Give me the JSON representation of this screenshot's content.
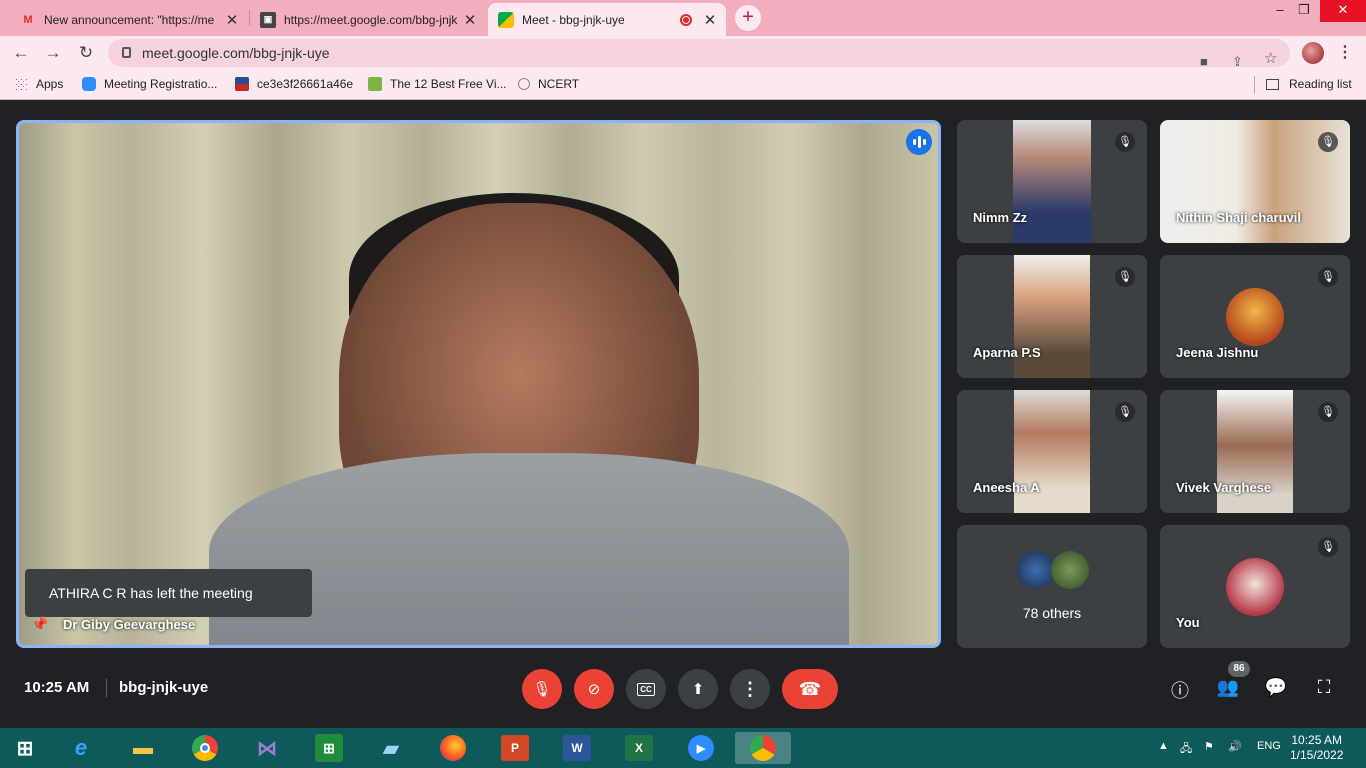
{
  "browser": {
    "tabs": [
      {
        "title": "New announcement: \"https://me",
        "favicon": "gmail-icon"
      },
      {
        "title": "https://meet.google.com/bbg-jnjk",
        "favicon": "meet-page-icon"
      },
      {
        "title": "Meet - bbg-jnjk-uye",
        "favicon": "meet-icon",
        "active": true
      }
    ],
    "url": "meet.google.com/bbg-jnjk-uye",
    "bookmarks": [
      "Apps",
      "Meeting Registratio...",
      "ce3e3f26661a46e",
      "The 12 Best Free Vi...",
      "NCERT"
    ],
    "reading_list": "Reading list"
  },
  "meet": {
    "main_speaker": "Dr Giby Geevarghese",
    "toast": "ATHIRA C R has left the meeting",
    "tiles": [
      {
        "name": "Nimm Zz"
      },
      {
        "name": "Nithin Shaji charuvil"
      },
      {
        "name": "Aparna P.S"
      },
      {
        "name": "Jeena Jishnu"
      },
      {
        "name": "Aneesha A"
      },
      {
        "name": "Vivek Varghese"
      },
      {
        "name": "78 others"
      },
      {
        "name": "You"
      }
    ],
    "time": "10:25 AM",
    "code": "bbg-jnjk-uye",
    "participant_count": "86"
  },
  "taskbar": {
    "lang": "ENG",
    "time": "10:25 AM",
    "date": "1/15/2022"
  },
  "colors": {
    "accent": "#8ab4f8",
    "danger": "#ea4335",
    "tab_bg": "#f2aebe"
  }
}
